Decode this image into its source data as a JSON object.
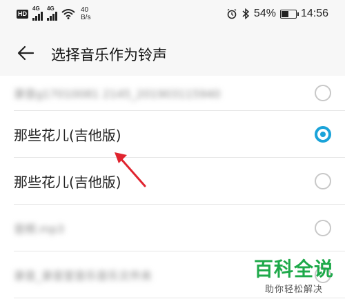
{
  "status_bar": {
    "hd": "HD",
    "net1": "4G",
    "net2": "4G",
    "speed_value": "40",
    "speed_unit": "B/s",
    "battery_percent": "54%",
    "battery_level": 0.54,
    "time": "14:56"
  },
  "header": {
    "title": "选择音乐作为铃声"
  },
  "list": {
    "items": [
      {
        "label": "录音g17010081 2145_201903115940",
        "blurred": true,
        "selected": false
      },
      {
        "label": "那些花儿(吉他版)",
        "blurred": false,
        "selected": true
      },
      {
        "label": "那些花儿(吉他版)",
        "blurred": false,
        "selected": false
      },
      {
        "label": "音频.mp3",
        "blurred": true,
        "selected": false
      },
      {
        "label": "录音_录音室音乐音乐文件夹",
        "blurred": true,
        "selected": false
      }
    ]
  },
  "watermark": {
    "title": "百科全说",
    "subtitle": "助你轻松解决"
  },
  "colors": {
    "accent": "#1aa3d9",
    "watermark_green": "#1ea94a",
    "annotation_red": "#e0242f"
  }
}
